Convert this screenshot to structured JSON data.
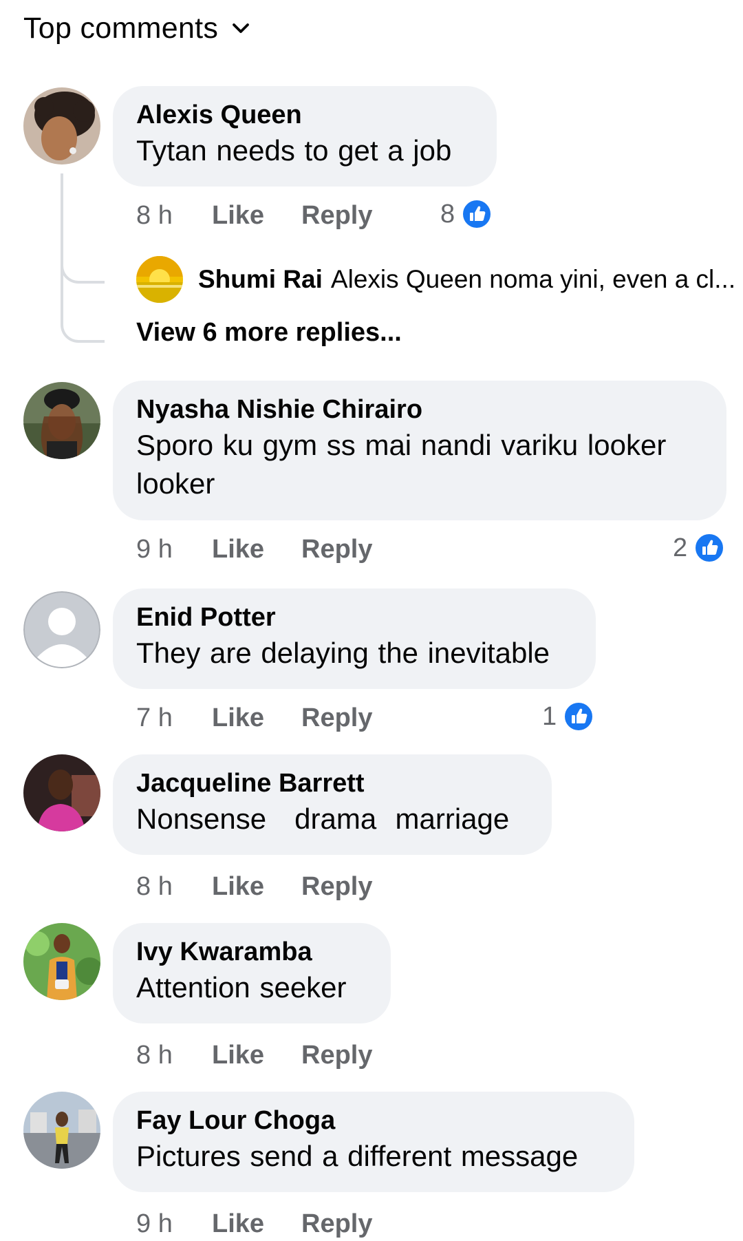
{
  "sort": {
    "label": "Top comments",
    "icon": "chevron-down-icon"
  },
  "comments": [
    {
      "author": "Alexis Queen",
      "text": "Tytan needs to get a job",
      "time": "8 h",
      "like_label": "Like",
      "reply_label": "Reply",
      "reactions": "8",
      "avatar_colors": [
        "#d9a57a",
        "#2a1f1a"
      ]
    },
    {
      "author": "Nyasha Nishie Chirairo",
      "text": "Sporo ku gym ss mai nandi variku looker looker",
      "time": "9 h",
      "like_label": "Like",
      "reply_label": "Reply",
      "reactions": "2",
      "avatar_colors": [
        "#6b7a5a",
        "#3a2418"
      ]
    },
    {
      "author": "Enid Potter",
      "text": "They are delaying the inevitable",
      "time": "7 h",
      "like_label": "Like",
      "reply_label": "Reply",
      "reactions": "1",
      "avatar_colors": [
        "#c8ccd2",
        "#ffffff"
      ]
    },
    {
      "author": "Jacqueline Barrett",
      "text": "Nonsense   drama  marriage",
      "time": "8 h",
      "like_label": "Like",
      "reply_label": "Reply",
      "reactions": "",
      "avatar_colors": [
        "#3a2a2a",
        "#d63a9e"
      ]
    },
    {
      "author": "Ivy Kwaramba",
      "text": "Attention seeker",
      "time": "8 h",
      "like_label": "Like",
      "reply_label": "Reply",
      "reactions": "",
      "avatar_colors": [
        "#6aa84f",
        "#e8a33a"
      ]
    },
    {
      "author": "Fay Lour Choga",
      "text": "Pictures send a different message",
      "time": "9 h",
      "like_label": "Like",
      "reply_label": "Reply",
      "reactions": "",
      "avatar_colors": [
        "#b9c7d6",
        "#e8d24a"
      ]
    }
  ],
  "reply_preview": {
    "author": "Shumi Rai",
    "snippet": "Alexis Queen noma yini, even a cl...",
    "view_more": "View 6 more replies..."
  },
  "colors": {
    "bubble": "#f0f2f5",
    "like_blue": "#1877f2",
    "meta_gray": "#65676b"
  }
}
